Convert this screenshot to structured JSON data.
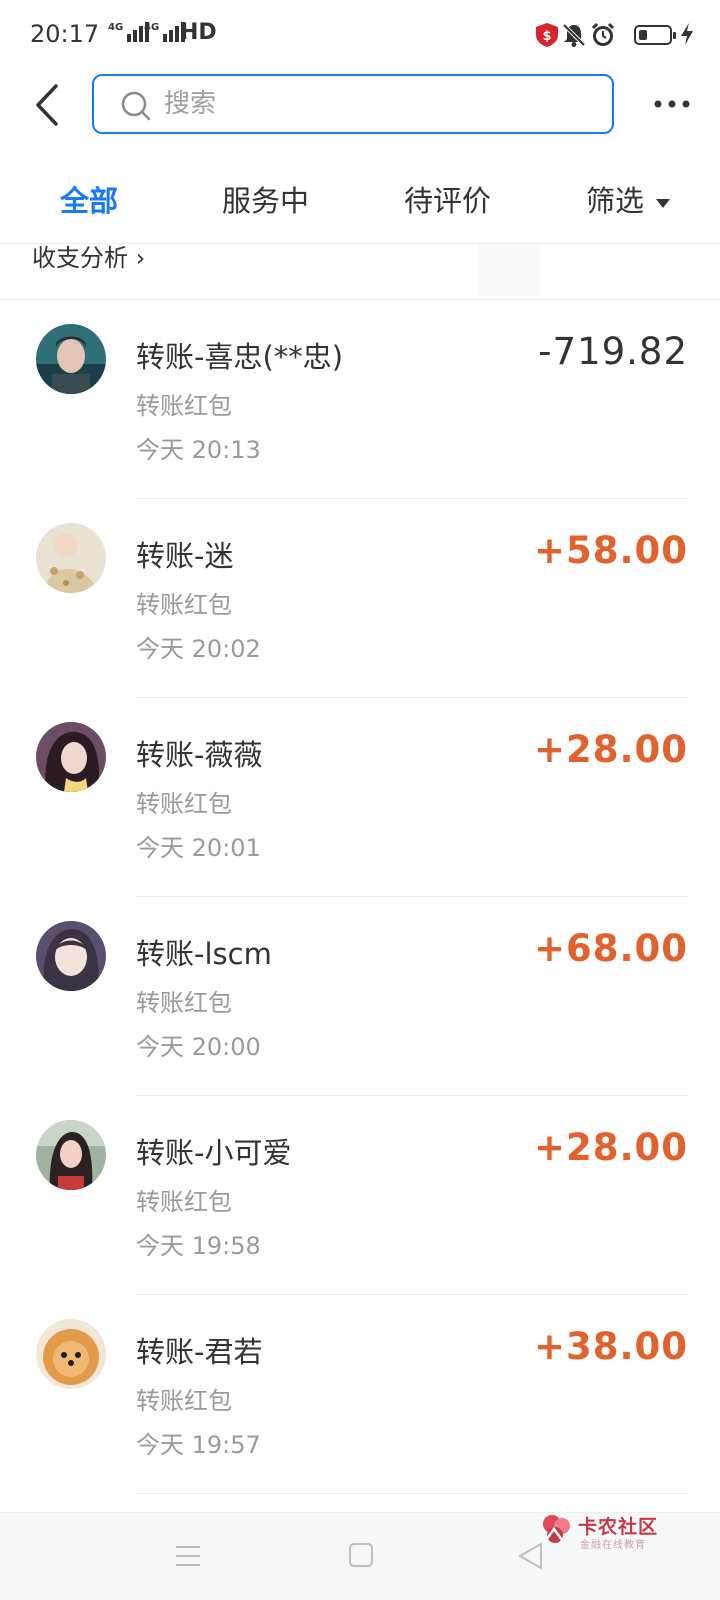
{
  "status_bar": {
    "time": "20:17",
    "network_1": "4G",
    "network_2": "4G",
    "hd": "HD"
  },
  "header": {
    "search_placeholder": "搜索"
  },
  "tabs": [
    {
      "label": "全部",
      "active": true
    },
    {
      "label": "服务中",
      "active": false
    },
    {
      "label": "待评价",
      "active": false
    },
    {
      "label": "筛选",
      "active": false
    }
  ],
  "analysis": {
    "label": "收支分析 ›"
  },
  "transactions": [
    {
      "title": "转账-喜忠(**忠)",
      "subtitle": "转账红包",
      "time": "今天  20:13",
      "amount": "-719.82",
      "direction": "out"
    },
    {
      "title": "转账-迷",
      "subtitle": "转账红包",
      "time": "今天  20:02",
      "amount": "+58.00",
      "direction": "in"
    },
    {
      "title": "转账-薇薇",
      "subtitle": "转账红包",
      "time": "今天  20:01",
      "amount": "+28.00",
      "direction": "in"
    },
    {
      "title": "转账-lscm",
      "subtitle": "转账红包",
      "time": "今天  20:00",
      "amount": "+68.00",
      "direction": "in"
    },
    {
      "title": "转账-小可爱",
      "subtitle": "转账红包",
      "time": "今天  19:58",
      "amount": "+28.00",
      "direction": "in"
    },
    {
      "title": "转账-君若",
      "subtitle": "转账红包",
      "time": "今天  19:57",
      "amount": "+38.00",
      "direction": "in"
    }
  ],
  "watermark": {
    "name": "卡农社区",
    "tagline": "金融在线教育"
  },
  "colors": {
    "accent": "#1677ff",
    "income": "#e2612c",
    "expense": "#333333",
    "secondary_text": "#9a9a9a"
  },
  "icons": [
    "back-arrow-icon",
    "search-icon",
    "more-icon",
    "filter-caret-icon",
    "shield-icon",
    "mute-bell-icon",
    "alarm-icon",
    "battery-icon",
    "charging-icon",
    "nav-menu-icon",
    "nav-home-icon",
    "nav-back-icon"
  ]
}
